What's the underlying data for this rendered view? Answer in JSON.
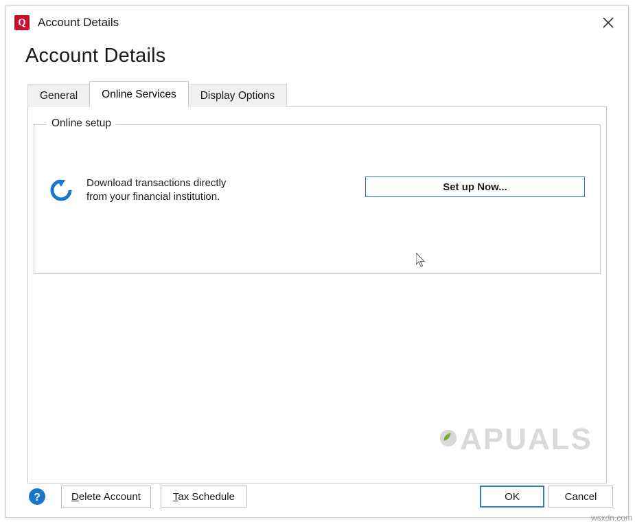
{
  "window": {
    "title": "Account Details",
    "app_icon": "quicken-q-icon",
    "close_icon": "close-icon"
  },
  "heading": "Account Details",
  "tabs": [
    {
      "label": "General",
      "active": false
    },
    {
      "label": "Online Services",
      "active": true
    },
    {
      "label": "Display Options",
      "active": false
    }
  ],
  "panel": {
    "group_title": "Online setup",
    "refresh_icon": "refresh-circular-arrow-icon",
    "download_text": "Download transactions directly from your financial institution.",
    "setup_button": "Set up Now..."
  },
  "footer": {
    "help_icon": "help-question-icon",
    "delete_account": "Delete Account",
    "tax_schedule": "Tax Schedule",
    "ok": "OK",
    "cancel": "Cancel"
  },
  "watermark": {
    "text": "PUALS",
    "prefix": "A",
    "site": "wsxdn.com"
  },
  "colors": {
    "accent_blue": "#2f7ac7",
    "app_red": "#c8102e",
    "border_gray": "#c9c9c9"
  }
}
